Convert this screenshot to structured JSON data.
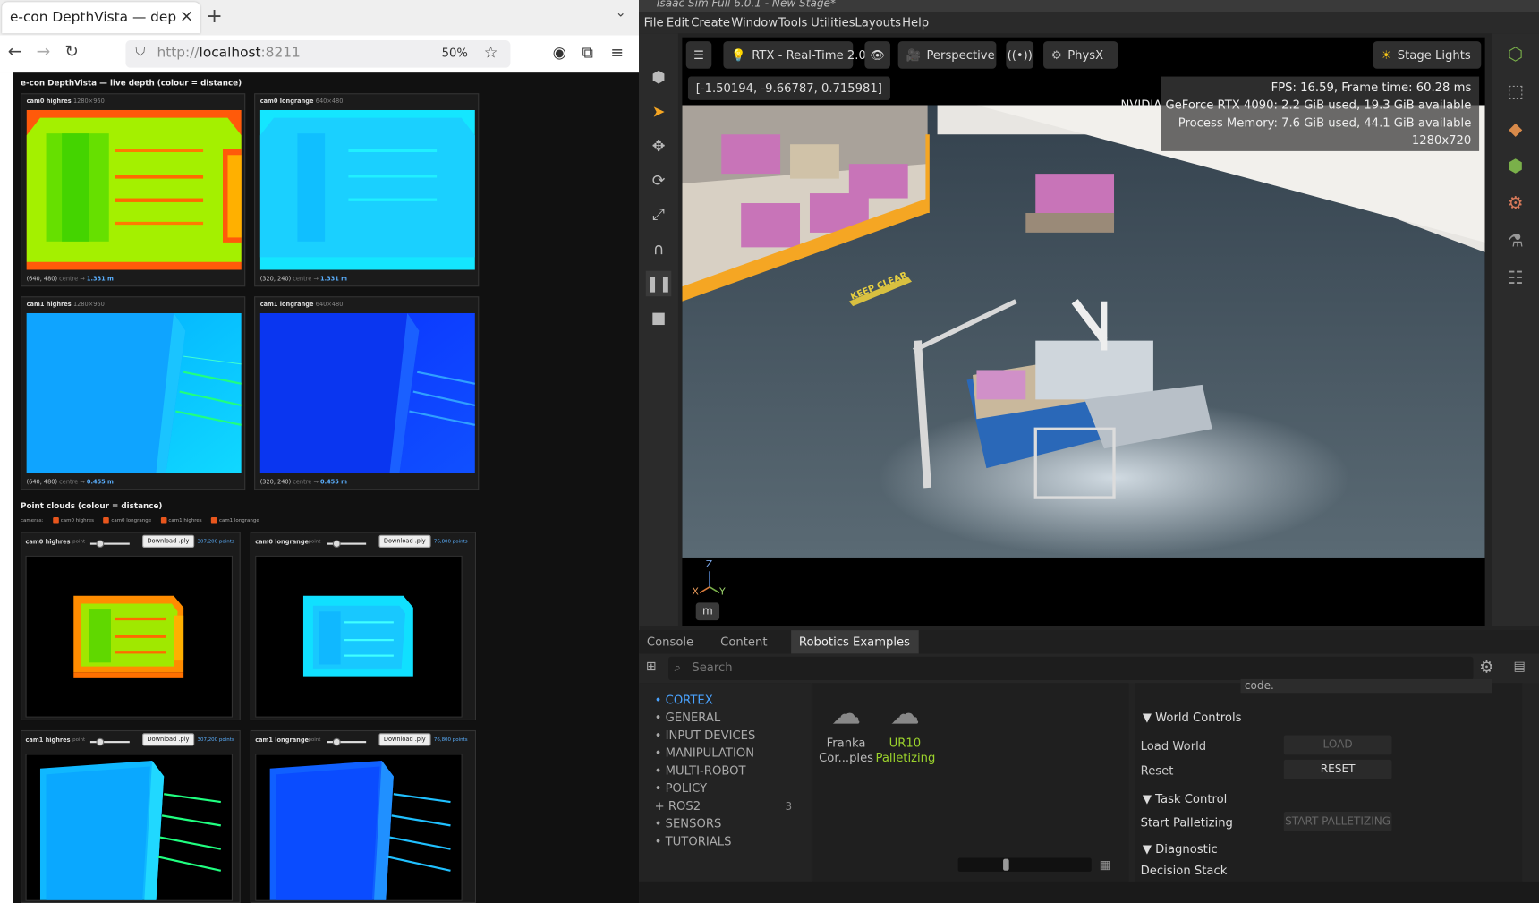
{
  "browser": {
    "tab_title": "e-con DepthVista — depth v",
    "url_prefix": "http://",
    "url_host": "localhost",
    "url_port": ":8211",
    "zoom": "50%"
  },
  "page": {
    "title": "e-con DepthVista — live depth (colour = distance)",
    "depth_cards": [
      {
        "name": "cam0 highres",
        "res": "1280×960",
        "pixel": "(640, 480)",
        "centre_label": "centre →",
        "distance": "1.331 m"
      },
      {
        "name": "cam0 longrange",
        "res": "640×480",
        "pixel": "(320, 240)",
        "centre_label": "centre →",
        "distance": "1.331 m"
      },
      {
        "name": "cam1 highres",
        "res": "1280×960",
        "pixel": "(640, 480)",
        "centre_label": "centre →",
        "distance": "0.455 m"
      },
      {
        "name": "cam1 longrange",
        "res": "640×480",
        "pixel": "(320, 240)",
        "centre_label": "centre →",
        "distance": "0.455 m"
      }
    ],
    "pc_title": "Point clouds (colour = distance)",
    "cameras_label": "cameras:",
    "camera_checks": [
      "cam0 highres",
      "cam0 longrange",
      "cam1 highres",
      "cam1 longrange"
    ],
    "pc_cards": [
      {
        "name": "cam0 highres",
        "point_label": "point",
        "download": "Download .ply",
        "points": "307,200 points"
      },
      {
        "name": "cam0 longrange",
        "point_label": "point",
        "download": "Download .ply",
        "points": "76,800 points"
      },
      {
        "name": "cam1 highres",
        "point_label": "point",
        "download": "Download .ply",
        "points": "307,200 points"
      },
      {
        "name": "cam1 longrange",
        "point_label": "point",
        "download": "Download .ply",
        "points": "76,800 points"
      }
    ]
  },
  "isaac": {
    "window_title": "Isaac Sim Full 6.0.1 - New Stage*",
    "menus": [
      "File",
      "Edit",
      "Create",
      "Window",
      "Tools",
      "Utilities",
      "Layouts",
      "Help"
    ],
    "viewport": {
      "renderer": "RTX - Real-Time 2.0",
      "camera": "Perspective",
      "physics": "PhysX",
      "lights": "Stage Lights",
      "coords": "[-1.50194, -9.66787, 0.715981]",
      "fps": "FPS: 16.59, Frame time: 60.28 ms",
      "gpu": "NVIDIA GeForce RTX 4090: 2.2 GiB used, 19.3 GiB available",
      "memory": "Process Memory: 7.6 GiB used, 44.1 GiB available",
      "resolution": "1280x720",
      "floor_text": "KEEP CLEAR",
      "axis_z": "Z",
      "axis_x": "X",
      "axis_y": "Y",
      "unit": "m"
    },
    "panel_tabs": [
      "Console",
      "Content",
      "Robotics Examples"
    ],
    "search_placeholder": "Search",
    "tree": [
      "CORTEX",
      "GENERAL",
      "INPUT DEVICES",
      "MANIPULATION",
      "MULTI-ROBOT",
      "POLICY",
      "ROS2",
      "SENSORS",
      "TUTORIALS"
    ],
    "tree_ros2_count": "3",
    "examples": [
      {
        "label1": "Franka",
        "label2": "Cor...ples"
      },
      {
        "label1": "UR10",
        "label2": "Palletizing"
      }
    ],
    "props": {
      "cut_text": "code.",
      "world_controls": "World Controls",
      "load_world": "Load World",
      "load_btn": "LOAD",
      "reset": "Reset",
      "reset_btn": "RESET",
      "task_control": "Task Control",
      "start_palletizing": "Start Palletizing",
      "start_btn": "START PALLETIZING",
      "diagnostic": "Diagnostic",
      "decision_stack": "Decision Stack"
    }
  }
}
